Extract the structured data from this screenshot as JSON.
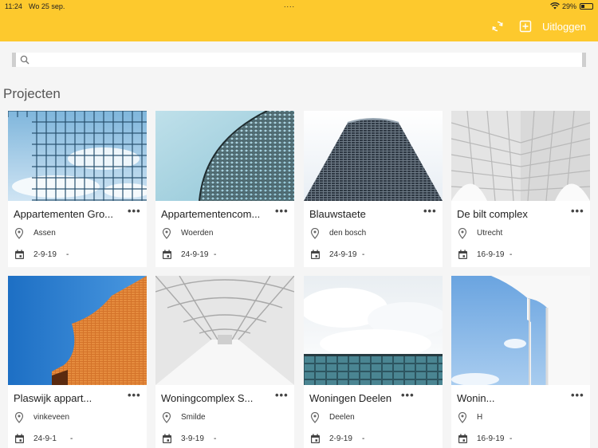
{
  "status": {
    "time": "11:24",
    "date": "Wo 25 sep.",
    "dots": "....",
    "battery": "29%"
  },
  "appbar": {
    "logout_label": "Uitloggen",
    "sync_icon": "sync-icon",
    "add_icon": "add-box-icon"
  },
  "search": {
    "value": "",
    "placeholder": ""
  },
  "section_title": "Projecten",
  "colors": {
    "accent": "#fdc92d",
    "background": "#f5f5f5"
  },
  "projects": [
    {
      "name": "Appartementen Gro...",
      "location": "Assen",
      "date": "2-9-19",
      "separator": "-"
    },
    {
      "name": "Appartementencom...",
      "location": "Woerden",
      "date": "24-9-19",
      "separator": "-"
    },
    {
      "name": "Blauwstaete",
      "location": "den bosch",
      "date": "24-9-19",
      "separator": "-"
    },
    {
      "name": "De bilt complex",
      "location": "Utrecht",
      "date": "16-9-19",
      "separator": "-"
    },
    {
      "name": "Plaswijk appart...",
      "location": "vinkeveen",
      "date": "24-9-1",
      "separator": "-"
    },
    {
      "name": "Woningcomplex S...",
      "location": "Smilde",
      "date": "3-9-19",
      "separator": "-"
    },
    {
      "name": "Woningen Deelen",
      "location": "Deelen",
      "date": "2-9-19",
      "separator": "-"
    },
    {
      "name": "Wonin...",
      "location": "H",
      "date": "16-9-19",
      "separator": "-"
    }
  ],
  "more_label": "•••"
}
